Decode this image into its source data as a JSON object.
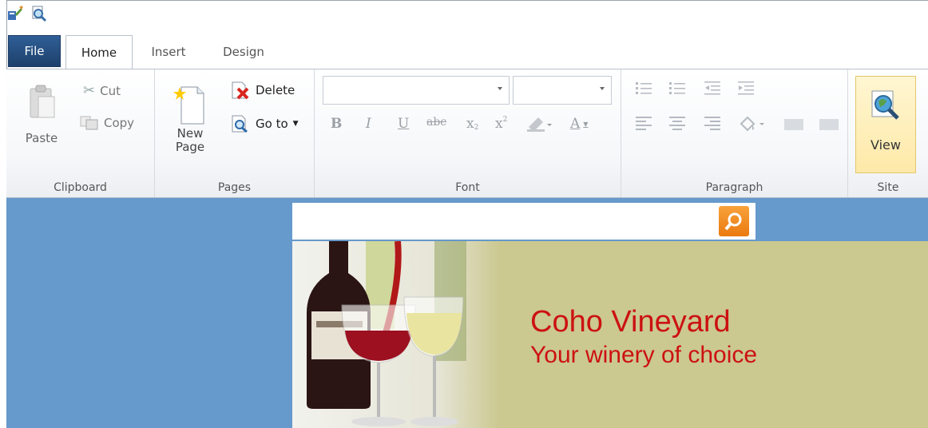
{
  "quick_access": {
    "icons": [
      "edit-properties-icon",
      "preview-icon"
    ]
  },
  "tabs": {
    "file": "File",
    "home": "Home",
    "insert": "Insert",
    "design": "Design"
  },
  "clipboard": {
    "paste": "Paste",
    "cut": "Cut",
    "copy": "Copy",
    "label": "Clipboard"
  },
  "pages": {
    "new_page_line1": "New",
    "new_page_line2": "Page",
    "delete": "Delete",
    "goto": "Go to",
    "label": "Pages"
  },
  "font": {
    "family_value": "",
    "size_value": "",
    "label": "Font",
    "bold": "B",
    "italic": "I",
    "underline": "U",
    "strike": "abc",
    "subscript": "x",
    "superscript": "x",
    "font_color": "A"
  },
  "paragraph": {
    "label": "Paragraph"
  },
  "site": {
    "view": "View",
    "label": "Site"
  },
  "content": {
    "search_placeholder": "",
    "brand_title": "Coho Vineyard",
    "brand_subtitle": "Your winery of choice"
  },
  "colors": {
    "content_bg": "#6699cc",
    "banner_bg": "#cbc890",
    "brand_text": "#cc1111",
    "search_button": "#f08c1e"
  }
}
